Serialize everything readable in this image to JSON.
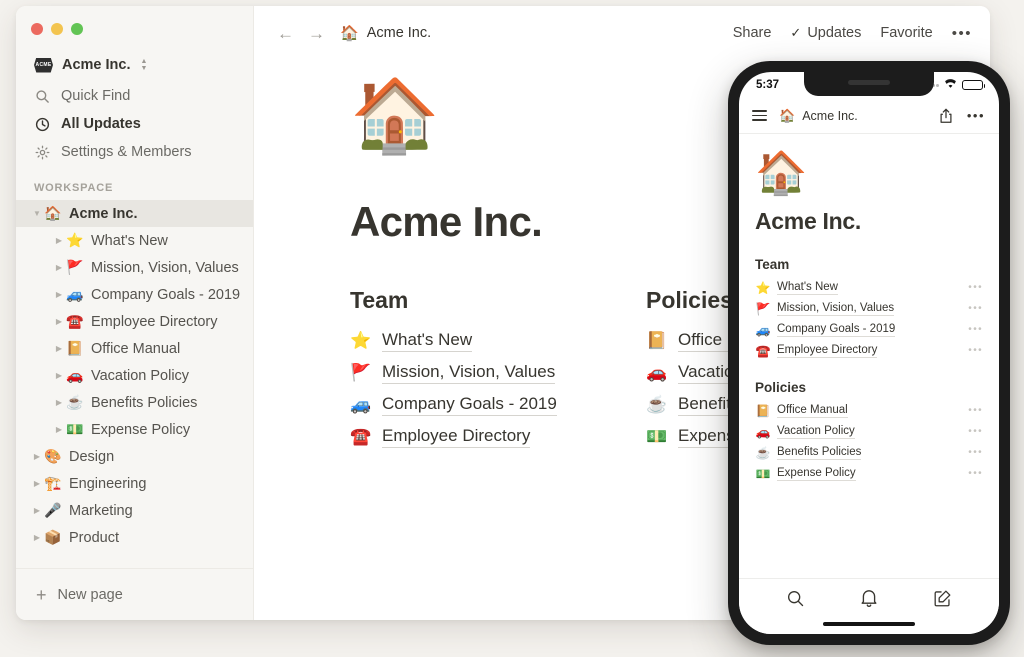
{
  "window": {
    "traffic_lights": [
      "close",
      "minimize",
      "zoom"
    ],
    "colors": {
      "sidebar_bg": "#f7f6f3",
      "main_bg": "#ffffff",
      "page_bg": "#f4f2ee",
      "text": "#37352f",
      "accent_red": "#ec6a5f",
      "accent_yellow": "#f3c44f",
      "accent_green": "#62c454"
    }
  },
  "sidebar": {
    "workspace_switcher": {
      "logo_text": "ACME",
      "name": "Acme Inc."
    },
    "nav": [
      {
        "label": "Quick Find",
        "icon": "search-icon",
        "strong": false
      },
      {
        "label": "All Updates",
        "icon": "clock-icon",
        "strong": true
      },
      {
        "label": "Settings & Members",
        "icon": "gear-icon",
        "strong": false
      }
    ],
    "section_label": "WORKSPACE",
    "tree": [
      {
        "label": "Acme Inc.",
        "emoji": "🏠",
        "depth": 0,
        "expanded": true,
        "selected": true
      },
      {
        "label": "What's New",
        "emoji": "⭐",
        "depth": 1,
        "expanded": false,
        "selected": false
      },
      {
        "label": "Mission, Vision, Values",
        "emoji": "🚩",
        "depth": 1,
        "expanded": false,
        "selected": false
      },
      {
        "label": "Company Goals - 2019",
        "emoji": "🚙",
        "depth": 1,
        "expanded": false,
        "selected": false
      },
      {
        "label": "Employee Directory",
        "emoji": "☎️",
        "depth": 1,
        "expanded": false,
        "selected": false
      },
      {
        "label": "Office Manual",
        "emoji": "📔",
        "depth": 1,
        "expanded": false,
        "selected": false
      },
      {
        "label": "Vacation Policy",
        "emoji": "🚗",
        "depth": 1,
        "expanded": false,
        "selected": false
      },
      {
        "label": "Benefits Policies",
        "emoji": "☕",
        "depth": 1,
        "expanded": false,
        "selected": false
      },
      {
        "label": "Expense Policy",
        "emoji": "💵",
        "depth": 1,
        "expanded": false,
        "selected": false
      },
      {
        "label": "Design",
        "emoji": "🎨",
        "depth": 0,
        "expanded": false,
        "selected": false
      },
      {
        "label": "Engineering",
        "emoji": "🏗️",
        "depth": 0,
        "expanded": false,
        "selected": false
      },
      {
        "label": "Marketing",
        "emoji": "🎤",
        "depth": 0,
        "expanded": false,
        "selected": false
      },
      {
        "label": "Product",
        "emoji": "📦",
        "depth": 0,
        "expanded": false,
        "selected": false
      }
    ],
    "footer": {
      "label": "New page",
      "icon": "plus-icon"
    }
  },
  "topbar": {
    "back_icon": "arrow-left-icon",
    "forward_icon": "arrow-right-icon",
    "breadcrumb": {
      "emoji": "🏠",
      "label": "Acme Inc."
    },
    "share_label": "Share",
    "updates_label": "Updates",
    "updates_icon": "check-icon",
    "favorite_label": "Favorite",
    "more_label": "•••"
  },
  "page": {
    "icon": "🏠",
    "title": "Acme Inc.",
    "columns": [
      {
        "heading": "Team",
        "links": [
          {
            "emoji": "⭐",
            "label": "What's New"
          },
          {
            "emoji": "🚩",
            "label": "Mission, Vision, Values"
          },
          {
            "emoji": "🚙",
            "label": "Company Goals - 2019"
          },
          {
            "emoji": "☎️",
            "label": "Employee Directory"
          }
        ]
      },
      {
        "heading": "Policies",
        "links": [
          {
            "emoji": "📔",
            "label": "Office Manual"
          },
          {
            "emoji": "🚗",
            "label": "Vacation Policy"
          },
          {
            "emoji": "☕",
            "label": "Benefits Policies"
          },
          {
            "emoji": "💵",
            "label": "Expense Policy"
          }
        ]
      }
    ]
  },
  "phone": {
    "status_bar": {
      "time": "5:37",
      "wifi_icon": "wifi-icon",
      "battery_icon": "battery-icon",
      "signal_icon": "signal-dots-icon"
    },
    "topbar": {
      "menu_icon": "hamburger-icon",
      "emoji": "🏠",
      "title": "Acme Inc.",
      "share_icon": "share-icon",
      "more_icon": "more-horizontal-icon",
      "more_label": "•••"
    },
    "page": {
      "icon": "🏠",
      "title": "Acme Inc.",
      "sections": [
        {
          "heading": "Team",
          "rows": [
            {
              "emoji": "⭐",
              "label": "What's New",
              "dots": "•••"
            },
            {
              "emoji": "🚩",
              "label": "Mission, Vision, Values",
              "dots": "•••"
            },
            {
              "emoji": "🚙",
              "label": "Company Goals - 2019",
              "dots": "•••"
            },
            {
              "emoji": "☎️",
              "label": "Employee Directory",
              "dots": "•••"
            }
          ]
        },
        {
          "heading": "Policies",
          "rows": [
            {
              "emoji": "📔",
              "label": "Office Manual",
              "dots": "•••"
            },
            {
              "emoji": "🚗",
              "label": "Vacation Policy",
              "dots": "•••"
            },
            {
              "emoji": "☕",
              "label": "Benefits Policies",
              "dots": "•••"
            },
            {
              "emoji": "💵",
              "label": "Expense Policy",
              "dots": "•••"
            }
          ]
        }
      ]
    },
    "tabbar": [
      {
        "icon": "search-icon",
        "name": "tab-search"
      },
      {
        "icon": "bell-icon",
        "name": "tab-notifications"
      },
      {
        "icon": "compose-icon",
        "name": "tab-compose"
      }
    ]
  }
}
